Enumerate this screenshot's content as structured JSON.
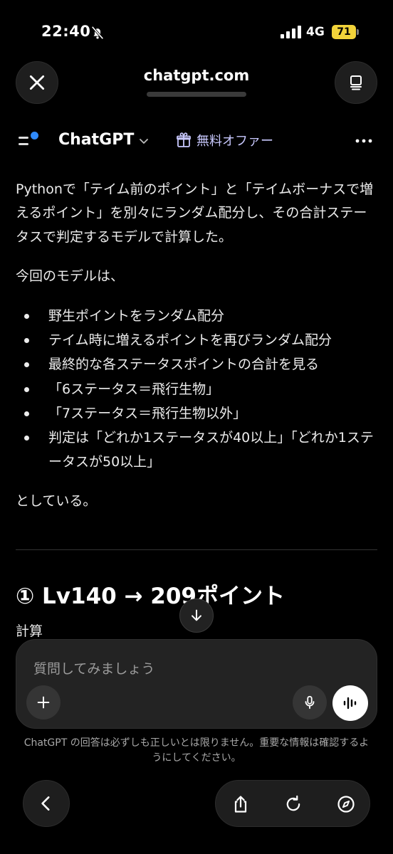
{
  "status_bar": {
    "time": "22:40",
    "network": "4G",
    "battery": "71",
    "battery_color": "#f2d33a"
  },
  "browser": {
    "url": "chatgpt.com",
    "close_icon": "close-icon",
    "tabs_icon": "tabs-icon"
  },
  "app_header": {
    "brand": "ChatGPT",
    "offer_label": "無料オファー",
    "accent": "#2f8bff"
  },
  "content": {
    "intro": "Pythonで「テイム前のポイント」と「テイムボーナスで増えるポイント」を別々にランダム配分し、その合計ステータスで判定するモデルで計算した。",
    "model_lead": "今回のモデルは、",
    "bullets": [
      "野生ポイントをランダム配分",
      "テイム時に増えるポイントを再びランダム配分",
      "最終的な各ステータスポイントの合計を見る",
      "「6ステータス＝飛行生物」",
      "「7ステータス＝飛行生物以外」",
      "判定は「どれか1ステータスが40以上」「どれか1ステータスが50以上」"
    ],
    "closing": "としている。",
    "heading": "① Lv140 → 209ポイント",
    "subheading": "計算"
  },
  "composer": {
    "placeholder": "質問してみましょう"
  },
  "disclaimer": "ChatGPT の回答は必ずしも正しいとは限りません。重要な情報は確認するようにしてください。"
}
